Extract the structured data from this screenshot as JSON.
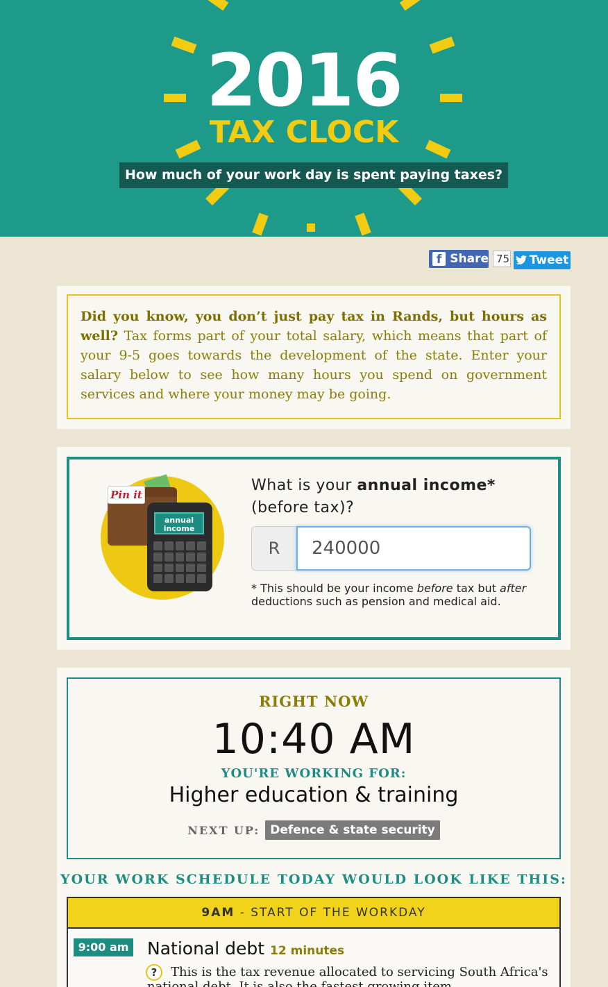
{
  "colors": {
    "teal": "#1d9a8a",
    "yellow": "#f2cc13",
    "olive": "#8b7e07",
    "cream": "#ede5d3"
  },
  "hero": {
    "year": "2016",
    "title": "TAX CLOCK",
    "subtitle": "How much of your work day is spent paying taxes?"
  },
  "social": {
    "share_label": "Share",
    "share_count": "75",
    "tweet_label": "Tweet",
    "facebook_icon": "facebook-icon",
    "twitter_icon": "twitter-bird-icon"
  },
  "intro": {
    "lead": "Did you know, you don’t just pay tax in Rands, but hours as well?",
    "body": " Tax forms part of your total salary, which means that part of your 9-5 goes towards the development of the state. Enter your salary below to see how many hours you spend on government services and where your money may be going."
  },
  "income": {
    "question_prefix": "What is your ",
    "question_bold": "annual income*",
    "question_suffix": "(before tax)?",
    "currency": "R",
    "value": "240000",
    "pinit": "Pin it",
    "calc_screen": "annual income",
    "note_1": "* This should be your income ",
    "note_em1": "before",
    "note_2": " tax but ",
    "note_em2": "after",
    "note_3": " deductions such as pension and medical aid."
  },
  "result": {
    "right_now_label": "RIGHT NOW",
    "time": "10:40 AM",
    "working_for_label": "YOU'RE WORKING FOR:",
    "working_for": "Higher education & training",
    "next_up_label": "NEXT UP:",
    "next_up": "Defence & state security"
  },
  "schedule": {
    "heading": "YOUR WORK SCHEDULE TODAY WOULD LOOK LIKE THIS:",
    "bar_bold": "9AM",
    "bar_rest": " - START OF THE WORKDAY",
    "items": [
      {
        "time": "9:00 am",
        "title": "National debt",
        "duration": "12 minutes",
        "description": "This is the tax revenue allocated to servicing South Africa's national debt. It is also the fastest growing item"
      }
    ]
  }
}
